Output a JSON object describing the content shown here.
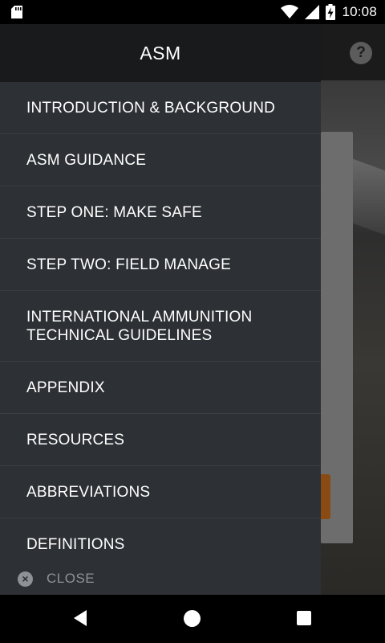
{
  "status_bar": {
    "time": "10:08",
    "icons": [
      "sd-card-icon",
      "wifi-icon",
      "signal-icon",
      "battery-charging-icon"
    ]
  },
  "app": {
    "toolbar_icon": "help-icon",
    "help_glyph": "?"
  },
  "drawer": {
    "title": "ASM",
    "items": [
      {
        "label": "INTRODUCTION & BACKGROUND"
      },
      {
        "label": "ASM GUIDANCE"
      },
      {
        "label": "STEP ONE: MAKE SAFE"
      },
      {
        "label": "STEP TWO: FIELD MANAGE"
      },
      {
        "label": "INTERNATIONAL AMMUNITION TECHNICAL GUIDELINES"
      },
      {
        "label": "APPENDIX"
      },
      {
        "label": "RESOURCES"
      },
      {
        "label": "ABBREVIATIONS"
      },
      {
        "label": "DEFINITIONS"
      }
    ],
    "close_label": "CLOSE",
    "close_glyph": "×"
  },
  "nav_bar": {
    "icons": [
      "back-icon",
      "home-icon",
      "recents-icon"
    ]
  },
  "colors": {
    "drawer_bg": "#2d3034",
    "drawer_header_bg": "#191a1c",
    "divider": "#3a3e43",
    "muted_text": "#8e9196",
    "accent_button": "#8a4a14"
  }
}
